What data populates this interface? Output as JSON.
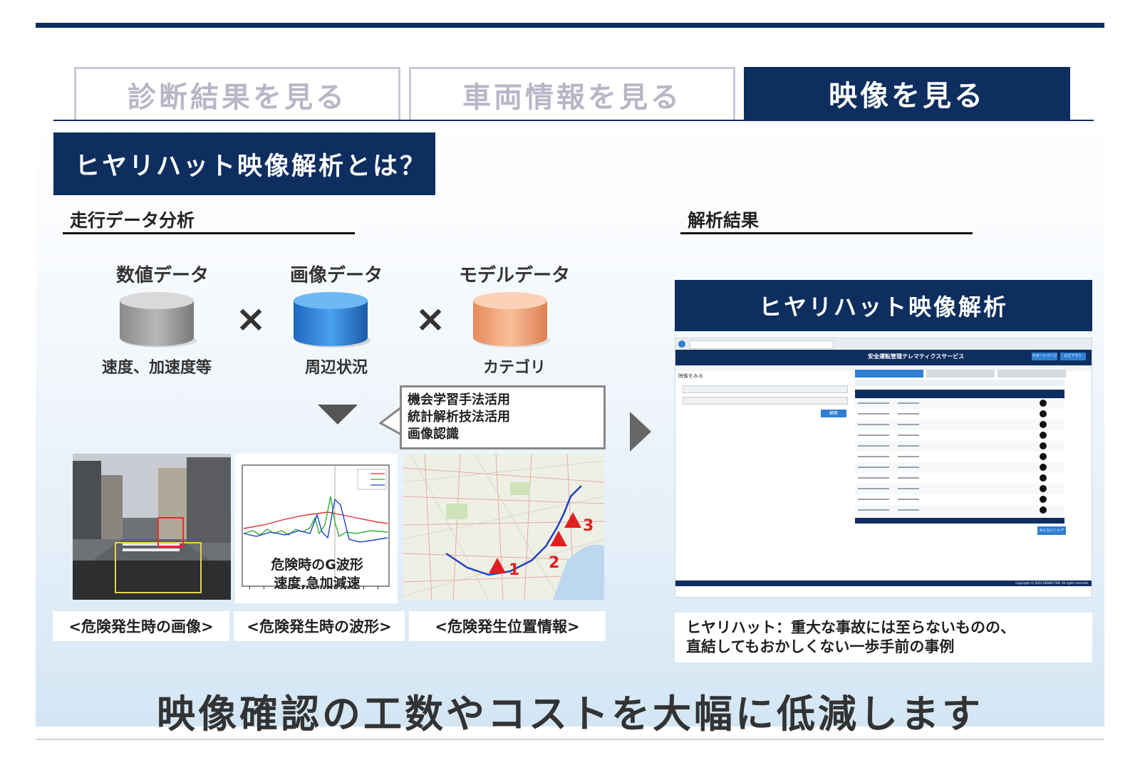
{
  "tabs": [
    {
      "label": "診断結果を見る",
      "active": false
    },
    {
      "label": "車両情報を見る",
      "active": false
    },
    {
      "label": "映像を見る",
      "active": true
    }
  ],
  "title": "ヒヤリハット映像解析とは？",
  "left_section": {
    "heading": "走行データ分析",
    "data_types": [
      {
        "label": "数値データ",
        "sub": "速度、加速度等",
        "color": "#9a9a9a"
      },
      {
        "label": "画像データ",
        "sub": "周辺状況",
        "color": "#2f7fd6"
      },
      {
        "label": "モデルデータ",
        "sub": "カテゴリ",
        "color": "#f2a47a"
      }
    ],
    "operator": "×",
    "callout_lines": [
      "機会学習手法活用",
      "統計解析技法活用",
      "画像認識"
    ],
    "graph_overlay_lines": [
      "危険時のG波形",
      "速度,急加減速"
    ],
    "map_markers": [
      "1",
      "2",
      "3"
    ],
    "captions": [
      "<危険発生時の画像>",
      "<危険発生時の波形>",
      "<危険発生位置情報>"
    ]
  },
  "right_section": {
    "heading": "解析結果",
    "panel_title": "ヒヤリハット映像解析",
    "screenshot": {
      "app_title": "安全運転管理テレマティクスサービス",
      "buttons": [
        "サポートページ",
        "ログアウト"
      ],
      "sub_title": "映像をみる",
      "search_button": "検索",
      "footer_button": "みんなにシェア",
      "copyright": "Copyright (c) 2015 DENSO TEN. All rights reserved."
    },
    "note_lines": [
      "ヒヤリハット：重大な事故には至らないものの、",
      "直結してもおかしくない一歩手前の事例"
    ]
  },
  "headline": "映像確認の工数やコストを大幅に低減します",
  "colors": {
    "navy": "#0d2e5e",
    "tab_inactive": "#b7b7c8",
    "marker_red": "#e02020"
  }
}
